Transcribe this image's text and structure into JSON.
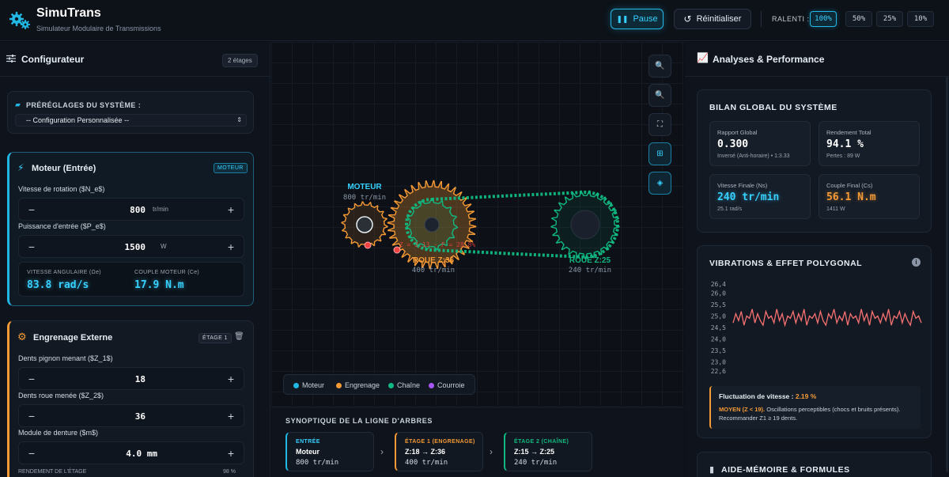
{
  "app": {
    "title": "SimuTrans",
    "subtitle": "Simulateur Modulaire de Transmissions"
  },
  "toolbar": {
    "pause_label": "Pause",
    "reset_label": "Réinitialiser",
    "slowmo_label": "RALENTI :",
    "speeds": [
      "100%",
      "50%",
      "25%",
      "10%"
    ],
    "active_speed": "100%"
  },
  "config": {
    "title": "Configurateur",
    "stages_badge": "2 étages",
    "presets": {
      "label": "PRÉRÉGLAGES DU SYSTÈME :",
      "selected": "-- Configuration Personnalisée --"
    },
    "motor": {
      "title": "Moteur (Entrée)",
      "tag": "MOTEUR",
      "speed_label": "Vitesse de rotation ($N_e$)",
      "speed_value": "800",
      "speed_unit": "tr/min",
      "power_label": "Puissance d'entrée ($P_e$)",
      "power_value": "1500",
      "power_unit": "W",
      "omega_label": "VITESSE ANGULAIRE (Ωe)",
      "omega_value": "83.8 rad/s",
      "torque_label": "COUPLE MOTEUR (Ce)",
      "torque_value": "17.9 N.m"
    },
    "gear": {
      "title": "Engrenage Externe",
      "tag": "ÉTAGE 1",
      "z1_label": "Dents pignon menant ($Z_1$)",
      "z1_value": "18",
      "z2_label": "Dents roue menée ($Z_2$)",
      "z2_value": "36",
      "module_label": "Module de denture ($m$)",
      "module_value": "4.0 mm",
      "eff_label": "RENDEMENT DE L'ÉTAGE",
      "eff_value": "98 %"
    }
  },
  "canvas": {
    "motor_label": "MOTEUR",
    "motor_speed": "800 tr/min",
    "wheel1_label": "ROUE Z:36",
    "wheel1_speed": "400 tr/min",
    "wheel2_label": "ROUE Z:25",
    "wheel2_speed": "240 tr/min",
    "overlay_text": "Z = 3.13 · F = 28.8%",
    "legend": [
      {
        "label": "Moteur",
        "color": "#22b8e6"
      },
      {
        "label": "Engrenage",
        "color": "#f59a35"
      },
      {
        "label": "Chaîne",
        "color": "#10b981"
      },
      {
        "label": "Courroie",
        "color": "#a855f7"
      }
    ]
  },
  "synoptic": {
    "title": "SYNOPTIQUE DE LA LIGNE D'ARBRES",
    "cards": [
      {
        "kicker": "ENTRÉE",
        "title": "Moteur",
        "value": "800 tr/min",
        "color": "#22b8e6"
      },
      {
        "kicker": "ÉTAGE 1 (ENGRENAGE)",
        "title": "Z:18 → Z:36",
        "value": "400 tr/min",
        "color": "#f59a35"
      },
      {
        "kicker": "ÉTAGE 2 (CHAÎNE)",
        "title": "Z:15 → Z:25",
        "value": "240 tr/min",
        "color": "#10b981"
      }
    ]
  },
  "analysis": {
    "title": "Analyses & Performance",
    "bilan": {
      "title": "BILAN GLOBAL DU SYSTÈME",
      "ratio": {
        "label": "Rapport Global",
        "value": "0.300",
        "sub": "Inversé (Anti-horaire) • 1:3.33"
      },
      "efficiency": {
        "label": "Rendement Total",
        "value": "94.1 %",
        "sub": "Pertes : 89 W"
      },
      "final_speed": {
        "label": "Vitesse Finale (Ns)",
        "value": "240 tr/min",
        "sub": "25.1 rad/s"
      },
      "final_torque": {
        "label": "Couple Final (Cs)",
        "value": "56.1 N.m",
        "sub": "1411 W"
      }
    },
    "vibrations": {
      "title": "VIBRATIONS & EFFET POLYGONAL",
      "fluct_label": "Fluctuation de vitesse :",
      "fluct_value": "2.19 %",
      "level": "MOYEN (Z < 19).",
      "note": "Oscillations perceptibles (chocs et bruits présents). Recommander Z1 ≥ 19 dents."
    },
    "memo_title": "AIDE-MÉMOIRE & FORMULES"
  },
  "chart_data": {
    "type": "line",
    "title": "",
    "ylim": [
      22.6,
      26.4
    ],
    "yticks": [
      "26,4",
      "26,0",
      "25,5",
      "25,0",
      "24,5",
      "24,0",
      "23,5",
      "23,0",
      "22,6"
    ],
    "series": [
      {
        "values": [
          24.7,
          25.1,
          24.8,
          25.2,
          24.6,
          25.0,
          24.9,
          25.3,
          24.7,
          25.1,
          24.8,
          24.6,
          25.2,
          24.9,
          25.0,
          24.7,
          25.3,
          24.8,
          25.1,
          24.6,
          25.0,
          24.9,
          25.2,
          24.7,
          25.1,
          24.8,
          25.3,
          24.6,
          25.0,
          24.9,
          25.1,
          24.7,
          25.2,
          24.8,
          24.6,
          25.1,
          24.9,
          25.3,
          24.7,
          25.0,
          24.8,
          25.2,
          24.6,
          25.1,
          24.9,
          25.0,
          24.7,
          25.3,
          24.8,
          25.1,
          24.6,
          25.2,
          24.9,
          25.0,
          24.7,
          25.1,
          24.8,
          25.3,
          24.6,
          25.0,
          24.9,
          25.2,
          24.7,
          25.1,
          24.8,
          24.6,
          25.2,
          24.9,
          25.0,
          24.7
        ]
      }
    ]
  }
}
